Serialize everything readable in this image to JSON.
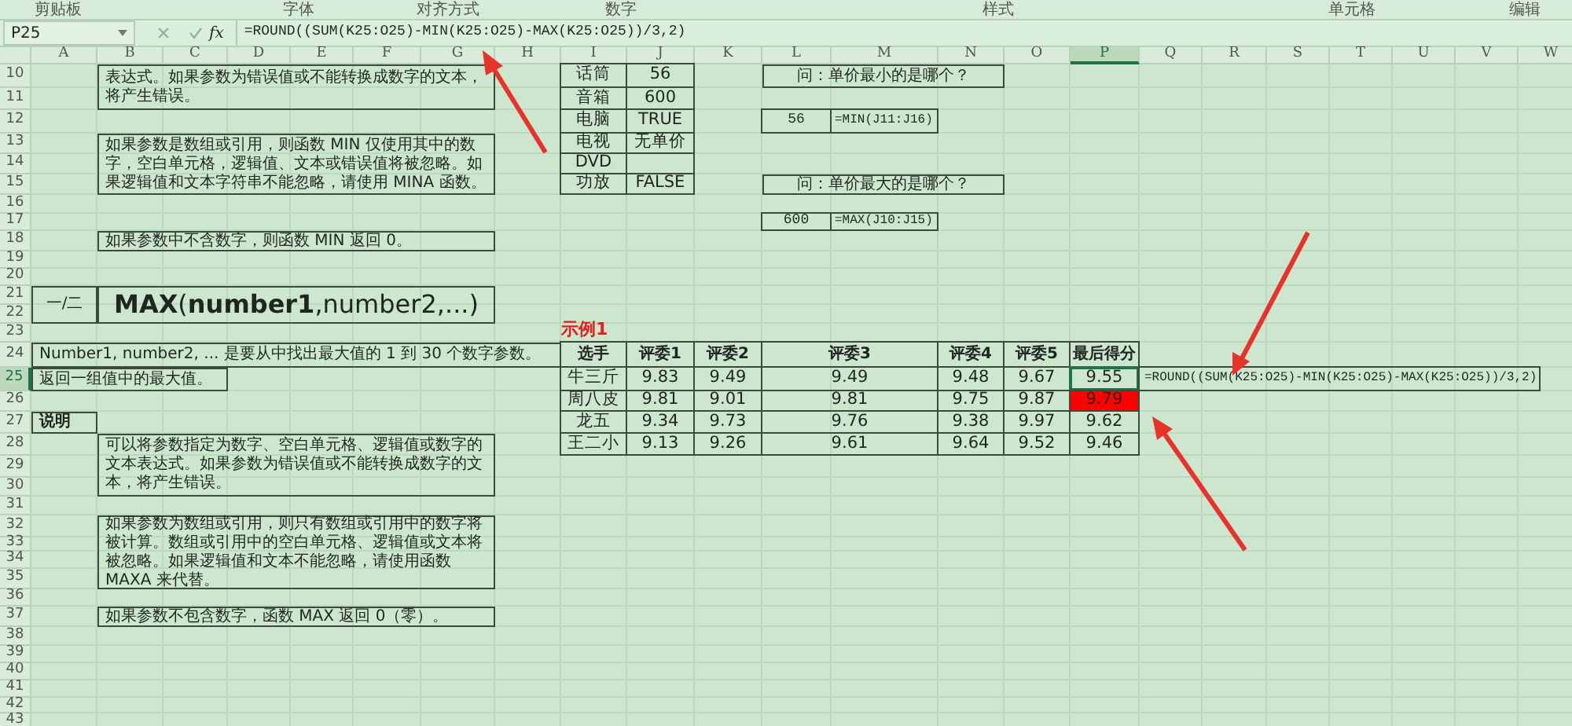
{
  "ribbon_groups": [
    "剪贴板",
    "字体",
    "对齐方式",
    "数字",
    "样式",
    "单元格",
    "编辑"
  ],
  "formula_bar": {
    "cell_ref": "P25",
    "function_label": "fx",
    "formula": "=ROUND((SUM(K25:O25)-MIN(K25:O25)-MAX(K25:O25))/3,2)"
  },
  "columns": [
    {
      "label": "A",
      "selected": false
    },
    {
      "label": "B",
      "selected": false
    },
    {
      "label": "C",
      "selected": false
    },
    {
      "label": "D",
      "selected": false
    },
    {
      "label": "E",
      "selected": false
    },
    {
      "label": "F",
      "selected": false
    },
    {
      "label": "G",
      "selected": false
    },
    {
      "label": "H",
      "selected": false
    },
    {
      "label": "I",
      "selected": false
    },
    {
      "label": "J",
      "selected": false
    },
    {
      "label": "K",
      "selected": false
    },
    {
      "label": "L",
      "selected": false
    },
    {
      "label": "M",
      "selected": false
    },
    {
      "label": "N",
      "selected": false
    },
    {
      "label": "O",
      "selected": false
    },
    {
      "label": "P",
      "selected": true
    },
    {
      "label": "Q",
      "selected": false
    },
    {
      "label": "R",
      "selected": false
    },
    {
      "label": "S",
      "selected": false
    },
    {
      "label": "T",
      "selected": false
    },
    {
      "label": "U",
      "selected": false
    },
    {
      "label": "V",
      "selected": false
    },
    {
      "label": "W",
      "selected": false
    }
  ],
  "rows": [
    {
      "label": "10",
      "selected": false
    },
    {
      "label": "11",
      "selected": false
    },
    {
      "label": "12",
      "selected": false
    },
    {
      "label": "13",
      "selected": false
    },
    {
      "label": "14",
      "selected": false
    },
    {
      "label": "15",
      "selected": false
    },
    {
      "label": "16",
      "selected": false
    },
    {
      "label": "17",
      "selected": false
    },
    {
      "label": "18",
      "selected": false
    },
    {
      "label": "19",
      "selected": false
    },
    {
      "label": "20",
      "selected": false
    },
    {
      "label": "21",
      "selected": false
    },
    {
      "label": "22",
      "selected": false
    },
    {
      "label": "23",
      "selected": false
    },
    {
      "label": "24",
      "selected": false
    },
    {
      "label": "25",
      "selected": true
    },
    {
      "label": "26",
      "selected": false
    },
    {
      "label": "27",
      "selected": false
    },
    {
      "label": "28",
      "selected": false
    },
    {
      "label": "29",
      "selected": false
    },
    {
      "label": "30",
      "selected": false
    },
    {
      "label": "31",
      "selected": false
    },
    {
      "label": "32",
      "selected": false
    },
    {
      "label": "33",
      "selected": false
    },
    {
      "label": "34",
      "selected": false
    },
    {
      "label": "35",
      "selected": false
    },
    {
      "label": "36",
      "selected": false
    },
    {
      "label": "37",
      "selected": false
    },
    {
      "label": "38",
      "selected": false
    },
    {
      "label": "39",
      "selected": false
    },
    {
      "label": "40",
      "selected": false
    },
    {
      "label": "41",
      "selected": false
    },
    {
      "label": "42",
      "selected": false
    },
    {
      "label": "43",
      "selected": false
    }
  ],
  "min_notes": [
    "表达式。如果参数为错误值或不能转换成数字的文本，将产生错误。",
    "如果参数是数组或引用，则函数 MIN 仅使用其中的数字，空白单元格，逻辑值、文本或错误值将被忽略。如果逻辑值和文本字符串不能忽略，请使用 MINA 函数。",
    "如果参数中不含数字，则函数 MIN 返回 0。"
  ],
  "max_section": {
    "section_number": "一/二",
    "syntax": "**MAX**(**number1**,number2,...)",
    "arguments": "Number1, number2, ... 是要从中找出最大值的 1 到 30 个数字参数。",
    "returns": "返回一组值中的最大值。",
    "remarks_label": "说明",
    "remarks": [
      "可以将参数指定为数字、空白单元格、逻辑值或数字的文本表达式。如果参数为错误值或不能转换成数字的文本，将产生错误。",
      "如果参数为数组或引用，则只有数组或引用中的数字将被计算。数组或引用中的空白单元格、逻辑值或文本将被忽略。如果逻辑值和文本不能忽略，请使用函数 MAXA 来代替。",
      "如果参数不包含数字，函数 MAX 返回 0（零）。"
    ]
  },
  "price_table": [
    {
      "item": "话筒",
      "price": "56"
    },
    {
      "item": "音箱",
      "price": "600"
    },
    {
      "item": "电脑",
      "price": "TRUE"
    },
    {
      "item": "电视",
      "price": "无单价"
    },
    {
      "item": "DVD"
    },
    {
      "item": "功放",
      "price": "FALSE"
    }
  ],
  "questions": [
    {
      "question": "问：单价最小的是哪个？",
      "answer": "56",
      "formula": "=MIN(J11:J16)"
    },
    {
      "question": "问：单价最大的是哪个？",
      "answer": "600",
      "formula": "=MAX(J10:J15)"
    }
  ],
  "example": {
    "title": "示例1",
    "columns": [
      "选手",
      "评委1",
      "评委2",
      "评委3",
      "评委4",
      "评委5",
      "最后得分"
    ],
    "rows": [
      {
        "name": "牛三斤",
        "scores": [
          "9.83",
          "9.49",
          "9.49",
          "9.48",
          "9.67"
        ],
        "final": {
          "value": "9.55",
          "selected": true,
          "highlighted": false
        }
      },
      {
        "name": "周八皮",
        "scores": [
          "9.81",
          "9.01",
          "9.81",
          "9.75",
          "9.87"
        ],
        "final": {
          "value": "9.79",
          "selected": false,
          "highlighted": true
        }
      },
      {
        "name": "龙五",
        "scores": [
          "9.34",
          "9.73",
          "9.76",
          "9.38",
          "9.97"
        ],
        "final": {
          "value": "9.62",
          "selected": false,
          "highlighted": false
        }
      },
      {
        "name": "王二小",
        "scores": [
          "9.13",
          "9.26",
          "9.61",
          "9.64",
          "9.52"
        ],
        "final": {
          "value": "9.46",
          "selected": false,
          "highlighted": false
        }
      }
    ],
    "formula_note": "=ROUND((SUM(K25:O25)-MIN(K25:O25)-MAX(K25:O25))/3,2)"
  }
}
